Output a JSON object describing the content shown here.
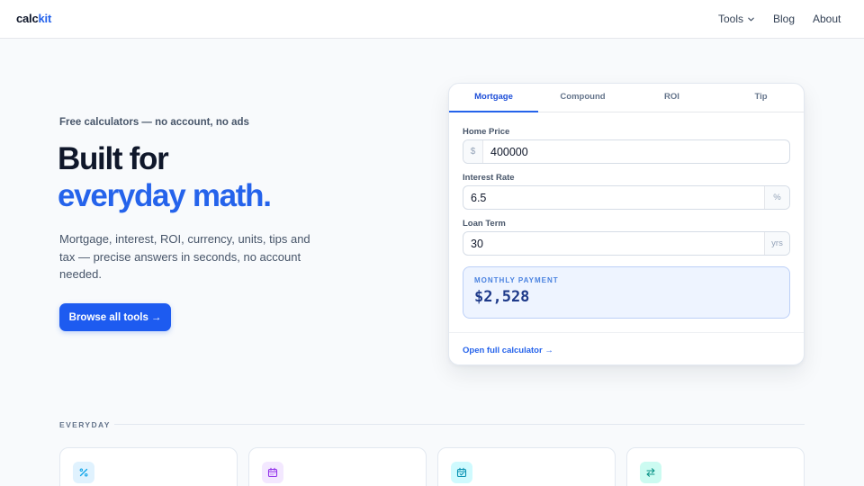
{
  "brand": {
    "name_part1": "calc",
    "name_part2": "kit"
  },
  "nav": {
    "tools": "Tools",
    "blog": "Blog",
    "about": "About"
  },
  "hero": {
    "eyebrow": "Free calculators — no account, no ads",
    "title_line1": "Built for",
    "title_line2": "everyday math.",
    "lead": "Mortgage, interest, ROI, currency, units, tips and tax — precise answers in seconds, no account needed.",
    "cta": "Browse all tools",
    "cta_arrow": "→"
  },
  "calculator": {
    "tabs": [
      "Mortgage",
      "Compound",
      "ROI",
      "Tip"
    ],
    "active_tab": "Mortgage",
    "fields": {
      "home_price": {
        "label": "Home Price",
        "prefix": "$",
        "value": "400000"
      },
      "interest_rate": {
        "label": "Interest Rate",
        "value": "6.5",
        "suffix": "%"
      },
      "loan_term": {
        "label": "Loan Term",
        "value": "30",
        "suffix": "yrs"
      }
    },
    "result": {
      "label": "MONTHLY PAYMENT",
      "value": "$2,528"
    },
    "footer_link": "Open full calculator →"
  },
  "everyday": {
    "label": "EVERYDAY",
    "tiles": [
      {
        "icon": "percent-icon",
        "color": "#0ea5e9",
        "bg": "#e0f2fe"
      },
      {
        "icon": "calendar-icon",
        "color": "#9333ea",
        "bg": "#f3e8ff"
      },
      {
        "icon": "calendar-check-icon",
        "color": "#0891b2",
        "bg": "#cffafe"
      },
      {
        "icon": "swap-arrows-icon",
        "color": "#0d9488",
        "bg": "#ccfbf1"
      }
    ]
  },
  "colors": {
    "accent": "#2563eb",
    "text": "#0f172a",
    "muted": "#475569",
    "background": "#f8fafc"
  }
}
